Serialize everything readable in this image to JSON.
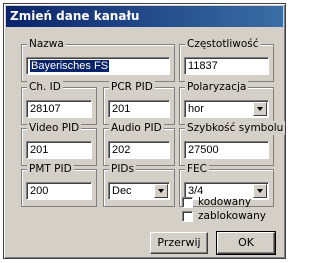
{
  "window": {
    "title": "Zmień dane kanału"
  },
  "groups": {
    "nazwa": {
      "label": "Nazwa",
      "value": "Bayerisches FS"
    },
    "czestotliwosc": {
      "label": "Częstotliwość",
      "value": "11837"
    },
    "ch_id": {
      "label": "Ch. ID",
      "value": "28107"
    },
    "pcr_pid": {
      "label": "PCR PID",
      "value": "201"
    },
    "polaryzacja": {
      "label": "Polaryzacja",
      "value": "hor"
    },
    "video_pid": {
      "label": "Video PID",
      "value": "201"
    },
    "audio_pid": {
      "label": "Audio PID",
      "value": "202"
    },
    "szybkosc": {
      "label": "Szybkość symbolu",
      "value": "27500"
    },
    "pmt_pid": {
      "label": "PMT PID",
      "value": "200"
    },
    "pids": {
      "label": "PIDs",
      "value": "Dec"
    },
    "fec": {
      "label": "FEC",
      "value": "3/4"
    }
  },
  "checkboxes": {
    "kodowany": {
      "label": "kodowany",
      "checked": false
    },
    "zablokowany": {
      "label": "zablokowany",
      "checked": false
    }
  },
  "buttons": {
    "cancel": "Przerwij",
    "ok": "OK"
  }
}
